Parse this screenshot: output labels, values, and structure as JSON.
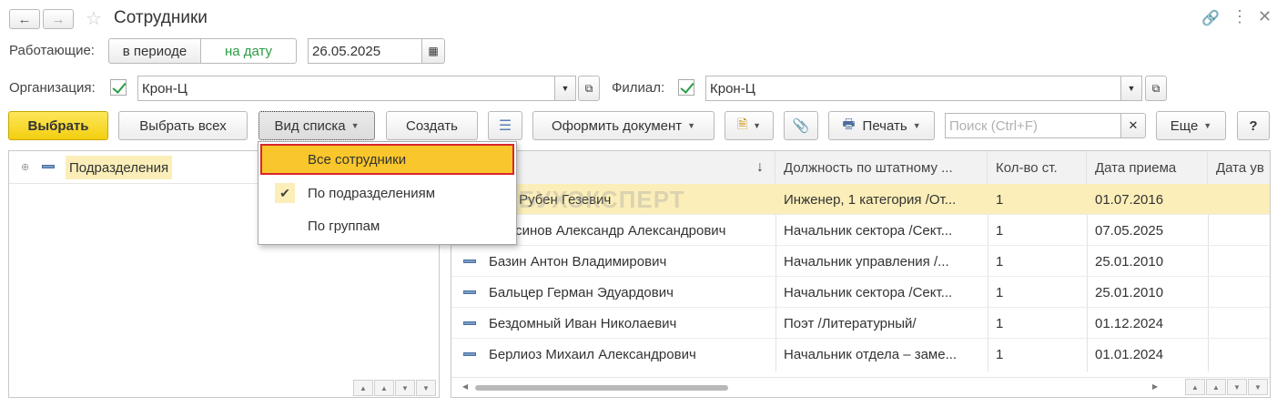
{
  "window": {
    "title": "Сотрудники",
    "back_icon": "arrow-left-icon",
    "forward_icon": "arrow-right-icon",
    "favorite_icon": "star-icon",
    "link_icon": "link-icon",
    "menu_icon": "kebab-menu-icon",
    "close_icon": "close-icon"
  },
  "filters": {
    "working_label": "Работающие:",
    "period_options": [
      "в периоде",
      "на дату"
    ],
    "period_selected": "на дату",
    "date_value": "26.05.2025",
    "org_label": "Организация:",
    "org_value": "Крон-Ц",
    "branch_label": "Филиал:",
    "branch_value": "Крон-Ц"
  },
  "toolbar": {
    "select_label": "Выбрать",
    "select_all_label": "Выбрать всех",
    "list_view_label": "Вид списка",
    "create_label": "Создать",
    "make_document_label": "Оформить документ",
    "print_label": "Печать",
    "search_placeholder": "Поиск (Ctrl+F)",
    "more_label": "Еще",
    "help_label": "?"
  },
  "dropdown": {
    "items": [
      {
        "label": "Все сотрудники",
        "highlighted": true,
        "checked": false
      },
      {
        "label": "По подразделениям",
        "highlighted": false,
        "checked": true
      },
      {
        "label": "По группам",
        "highlighted": false,
        "checked": false
      }
    ]
  },
  "tree": {
    "root_label": "Подразделения"
  },
  "watermark": "БУХЭКСПЕРТ",
  "table": {
    "columns": [
      "",
      "Должность по штатному ...",
      "Кол-во ст.",
      "Дата приема",
      "Дата ув"
    ],
    "sort_indicator": "↓",
    "rows": [
      {
        "name": "...ян Рубен Гезевич",
        "position": "Инженер, 1 категория /От...",
        "count": "1",
        "hired": "01.07.2016",
        "fired": "",
        "selected": true
      },
      {
        "name": "...льсинов Александр Александрович",
        "position": "Начальник сектора /Сект...",
        "count": "1",
        "hired": "07.05.2025",
        "fired": "",
        "selected": false
      },
      {
        "name": "Базин Антон Владимирович",
        "position": "Начальник управления /...",
        "count": "1",
        "hired": "25.01.2010",
        "fired": "",
        "selected": false
      },
      {
        "name": "Бальцер Герман Эдуардович",
        "position": "Начальник сектора /Сект...",
        "count": "1",
        "hired": "25.01.2010",
        "fired": "",
        "selected": false
      },
      {
        "name": "Бездомный Иван Николаевич",
        "position": "Поэт /Литературный/",
        "count": "1",
        "hired": "01.12.2024",
        "fired": "",
        "selected": false
      },
      {
        "name": "Берлиоз Михаил Александрович",
        "position": "Начальник отдела – заме...",
        "count": "1",
        "hired": "01.01.2024",
        "fired": "",
        "selected": false
      }
    ]
  },
  "colors": {
    "accent_yellow": "#f7d71d",
    "menu_highlight": "#f9c62b",
    "menu_border": "#d8262b",
    "selected_row": "#fbeeb8",
    "check_green": "#2a9d44"
  }
}
